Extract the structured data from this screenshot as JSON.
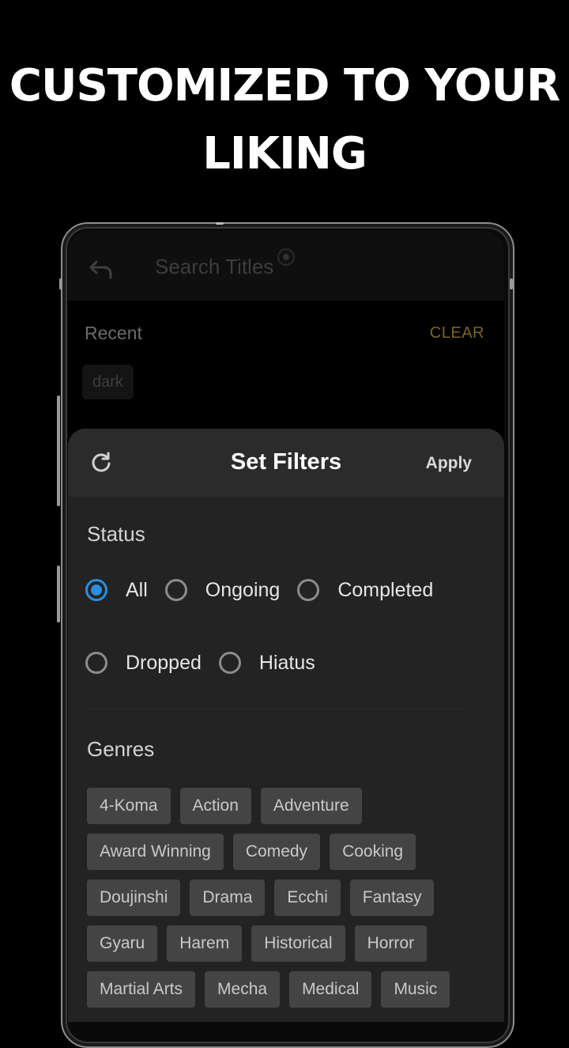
{
  "headline": {
    "line1": "CUSTOMIZED TO YOUR",
    "line2": "LIKING"
  },
  "search": {
    "placeholder": "Search Titles"
  },
  "recent": {
    "label": "Recent",
    "clear_label": "CLEAR",
    "items": [
      "dark"
    ]
  },
  "filters": {
    "title": "Set Filters",
    "apply_label": "Apply",
    "status": {
      "label": "Status",
      "options": [
        "All",
        "Ongoing",
        "Completed",
        "Dropped",
        "Hiatus"
      ],
      "selected": "All"
    },
    "genres": {
      "label": "Genres",
      "items": [
        "4-Koma",
        "Action",
        "Adventure",
        "Award Winning",
        "Comedy",
        "Cooking",
        "Doujinshi",
        "Drama",
        "Ecchi",
        "Fantasy",
        "Gyaru",
        "Harem",
        "Historical",
        "Horror",
        "Martial Arts",
        "Mecha",
        "Medical",
        "Music"
      ]
    }
  },
  "colors": {
    "accent": "#2c8ee0",
    "clear": "#7a6426",
    "sheet": "#232323",
    "chip": "#444444"
  },
  "icons": {
    "back": "back-arrow-icon",
    "reset": "refresh-icon"
  }
}
